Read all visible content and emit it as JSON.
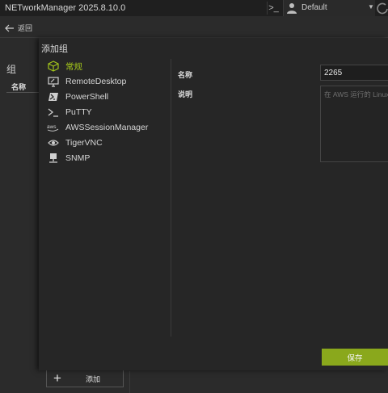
{
  "app": {
    "title": "NETworkManager 2025.8.10.0",
    "profile": "Default"
  },
  "back": {
    "label": "返回"
  },
  "background": {
    "group_title": "组",
    "column_name": "名称",
    "add_label": "添加"
  },
  "dialog": {
    "title": "添加组",
    "nav": [
      {
        "label": "常规",
        "icon": "cube-icon",
        "active": true
      },
      {
        "label": "RemoteDesktop",
        "icon": "monitor-icon"
      },
      {
        "label": "PowerShell",
        "icon": "powershell-icon"
      },
      {
        "label": "PuTTY",
        "icon": "terminal-icon"
      },
      {
        "label": "AWSSessionManager",
        "icon": "aws-icon"
      },
      {
        "label": "TigerVNC",
        "icon": "eye-icon"
      },
      {
        "label": "SNMP",
        "icon": "server-icon"
      }
    ],
    "fields": {
      "name_label": "名称",
      "name_value": "2265",
      "description_label": "说明",
      "description_placeholder": "在 AWS 运行的 Linux"
    },
    "save_label": "保存"
  },
  "colors": {
    "accent": "#a2c51b",
    "save_button": "#8aa81c",
    "background": "#2b2b2b",
    "dialog": "#262626"
  }
}
